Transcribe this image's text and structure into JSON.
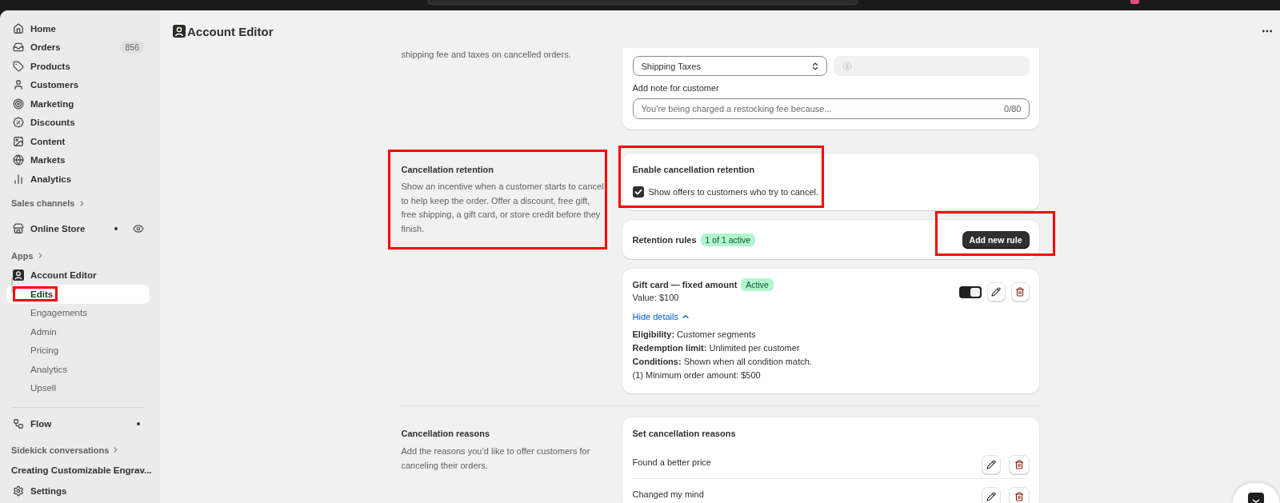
{
  "sidebar": {
    "items": [
      {
        "label": "Home",
        "selected": false
      },
      {
        "label": "Orders",
        "badge": "856",
        "selected": false
      },
      {
        "label": "Products",
        "selected": false
      },
      {
        "label": "Customers",
        "selected": false
      },
      {
        "label": "Marketing",
        "selected": false
      },
      {
        "label": "Discounts",
        "selected": false
      },
      {
        "label": "Content",
        "selected": false
      },
      {
        "label": "Markets",
        "selected": false
      },
      {
        "label": "Analytics",
        "selected": false
      }
    ],
    "sales_channels": {
      "heading": "Sales channels",
      "items": [
        {
          "label": "Online Store",
          "notification": true,
          "selected": false
        }
      ]
    },
    "apps": {
      "heading": "Apps",
      "items": [
        {
          "label": "Account Editor",
          "selected": false,
          "children": [
            {
              "label": "Edits",
              "selected": true,
              "highlighted": true
            },
            {
              "label": "Engagements",
              "selected": false
            },
            {
              "label": "Admin",
              "selected": false
            },
            {
              "label": "Pricing",
              "selected": false
            },
            {
              "label": "Analytics",
              "selected": false
            },
            {
              "label": "Upsell",
              "selected": false
            }
          ]
        }
      ]
    },
    "tools": [
      {
        "label": "Flow",
        "notification": true,
        "selected": false
      }
    ],
    "sidekick": {
      "heading": "Sidekick conversations",
      "items": [
        {
          "label": "Creating Customizable Engrav..."
        }
      ]
    },
    "footer": [
      {
        "label": "Settings",
        "selected": false
      }
    ]
  },
  "header": {
    "title": "Account Editor"
  },
  "restocking": {
    "description": "shipping fee and taxes on cancelled orders.",
    "fee_type": {
      "value": "Shipping Taxes"
    },
    "amount": {
      "disabled": true
    },
    "note": {
      "label": "Add note for customer",
      "placeholder": "You’re being charged a restocking fee because...",
      "counter": "0/80"
    }
  },
  "retention": {
    "title": "Cancellation retention",
    "description": "Show an incentive when a customer starts to cancel to help keep the order. Offer a discount, free gift, free shipping, a gift card, or store credit before they finish.",
    "highlighted": true,
    "enable_card": {
      "title": "Enable cancellation retention",
      "highlighted": true,
      "checkbox": {
        "label": "Show offers to customers who try to cancel.",
        "checked": true
      }
    },
    "rules_header": {
      "title": "Retention rules",
      "badge": "1 of 1 active",
      "button": {
        "label": "Add new rule",
        "highlighted": true
      }
    },
    "rules": [
      {
        "title": "Gift card — fixed amount",
        "status": "Active",
        "value": "Value: $100",
        "on": true,
        "details_link": "Hide details",
        "expanded": true,
        "details": [
          "**Eligibility:** Customer segments",
          "**Redemption limit:** Unlimited per customer",
          "**Conditions:** Shown when all condition match.",
          "(1) Minimum order amount: $500"
        ]
      }
    ]
  },
  "reasons": {
    "title": "Cancellation reasons",
    "description": "Add the reasons you’d like to offer customers for canceling their orders.",
    "card": {
      "title": "Set cancellation reasons",
      "items": [
        {
          "label": "Found a better price"
        },
        {
          "label": "Changed my mind"
        }
      ]
    }
  }
}
